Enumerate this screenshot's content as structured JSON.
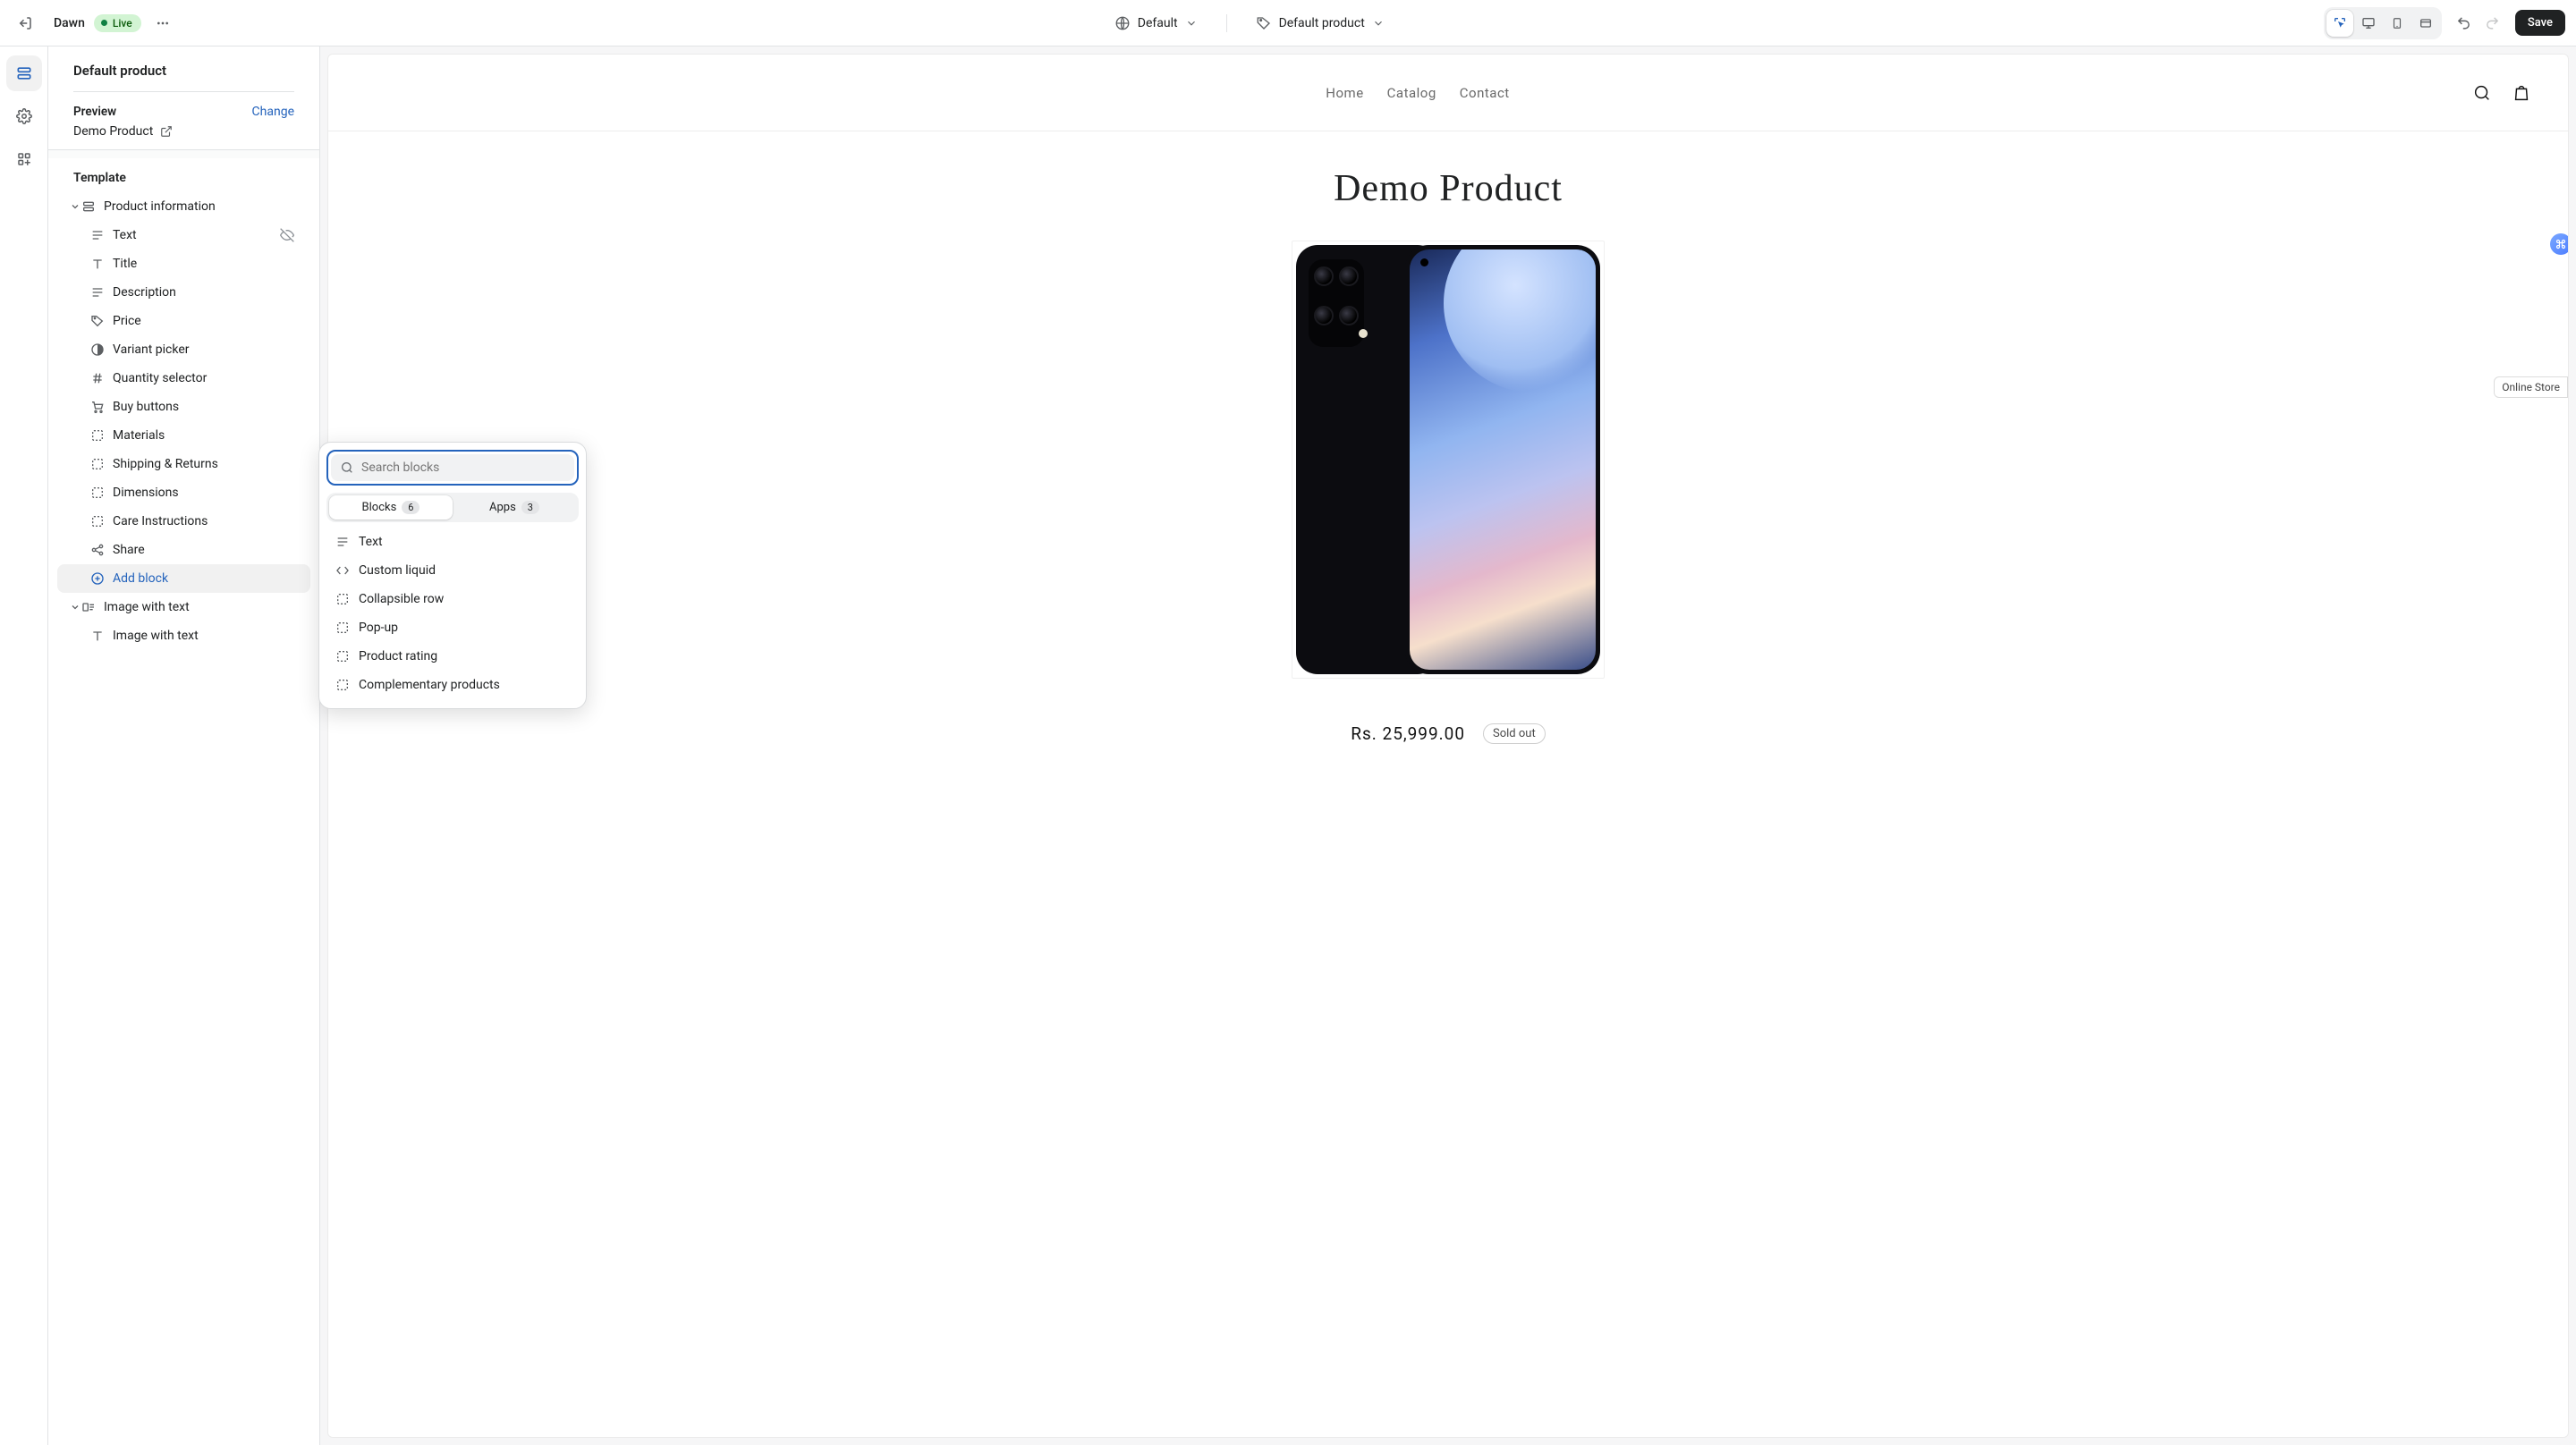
{
  "topbar": {
    "theme_name": "Dawn",
    "live_label": "Live",
    "locale_label": "Default",
    "template_label": "Default product",
    "save_label": "Save"
  },
  "sidebar": {
    "page_title": "Default product",
    "preview_label": "Preview",
    "change_label": "Change",
    "preview_product": "Demo Product",
    "template_header": "Template",
    "section_product_info": "Product information",
    "blocks": {
      "text": "Text",
      "title": "Title",
      "description": "Description",
      "price": "Price",
      "variant_picker": "Variant picker",
      "quantity_selector": "Quantity selector",
      "buy_buttons": "Buy buttons",
      "materials": "Materials",
      "shipping_returns": "Shipping & Returns",
      "dimensions": "Dimensions",
      "care_instructions": "Care Instructions",
      "share": "Share"
    },
    "add_block": "Add block",
    "section_image_with_text": "Image with text",
    "block_image_with_text": "Image with text"
  },
  "popup": {
    "search_placeholder": "Search blocks",
    "tab_blocks": "Blocks",
    "tab_blocks_count": "6",
    "tab_apps": "Apps",
    "tab_apps_count": "3",
    "items": {
      "text": "Text",
      "custom_liquid": "Custom liquid",
      "collapsible_row": "Collapsible row",
      "popup": "Pop-up",
      "product_rating": "Product rating",
      "complementary_products": "Complementary products"
    }
  },
  "store": {
    "nav_home": "Home",
    "nav_catalog": "Catalog",
    "nav_contact": "Contact",
    "product_title": "Demo Product",
    "price": "Rs. 25,999.00",
    "sold_out": "Sold out",
    "online_store": "Online Store"
  }
}
